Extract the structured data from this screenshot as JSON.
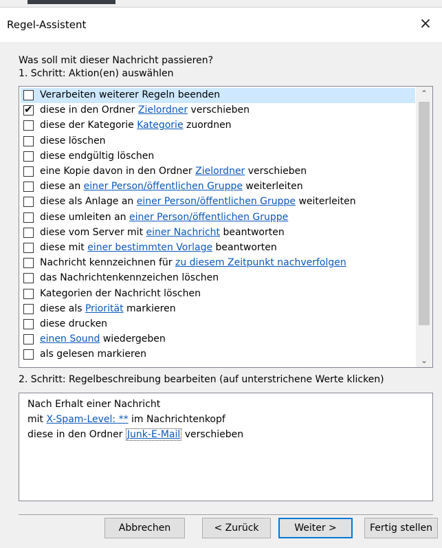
{
  "window": {
    "title": "Regel-Assistent"
  },
  "question": "Was soll mit dieser Nachricht passieren?",
  "step1_label": "1. Schritt: Aktion(en) auswählen",
  "actions": [
    {
      "checked": false,
      "selected": true,
      "parts": [
        {
          "t": "Verarbeiten weiterer Regeln beenden"
        }
      ]
    },
    {
      "checked": true,
      "parts": [
        {
          "t": "diese in den Ordner "
        },
        {
          "t": "Zielordner",
          "link": true
        },
        {
          "t": " verschieben"
        }
      ]
    },
    {
      "checked": false,
      "parts": [
        {
          "t": "diese der Kategorie "
        },
        {
          "t": "Kategorie",
          "link": true
        },
        {
          "t": " zuordnen"
        }
      ]
    },
    {
      "checked": false,
      "parts": [
        {
          "t": "diese löschen"
        }
      ]
    },
    {
      "checked": false,
      "parts": [
        {
          "t": "diese endgültig löschen"
        }
      ]
    },
    {
      "checked": false,
      "parts": [
        {
          "t": "eine Kopie davon in den Ordner "
        },
        {
          "t": "Zielordner",
          "link": true
        },
        {
          "t": " verschieben"
        }
      ]
    },
    {
      "checked": false,
      "parts": [
        {
          "t": "diese an "
        },
        {
          "t": "einer Person/öffentlichen Gruppe",
          "link": true
        },
        {
          "t": " weiterleiten"
        }
      ]
    },
    {
      "checked": false,
      "parts": [
        {
          "t": "diese als Anlage an "
        },
        {
          "t": "einer Person/öffentlichen Gruppe",
          "link": true
        },
        {
          "t": " weiterleiten"
        }
      ]
    },
    {
      "checked": false,
      "parts": [
        {
          "t": "diese umleiten an "
        },
        {
          "t": "einer Person/öffentlichen Gruppe",
          "link": true
        }
      ]
    },
    {
      "checked": false,
      "parts": [
        {
          "t": "diese vom Server mit "
        },
        {
          "t": "einer Nachricht",
          "link": true
        },
        {
          "t": " beantworten"
        }
      ]
    },
    {
      "checked": false,
      "parts": [
        {
          "t": "diese mit "
        },
        {
          "t": "einer bestimmten Vorlage",
          "link": true
        },
        {
          "t": " beantworten"
        }
      ]
    },
    {
      "checked": false,
      "parts": [
        {
          "t": "Nachricht kennzeichnen für "
        },
        {
          "t": "zu diesem Zeitpunkt nachverfolgen",
          "link": true
        }
      ]
    },
    {
      "checked": false,
      "parts": [
        {
          "t": "das Nachrichtenkennzeichen löschen"
        }
      ]
    },
    {
      "checked": false,
      "parts": [
        {
          "t": "Kategorien der Nachricht löschen"
        }
      ]
    },
    {
      "checked": false,
      "parts": [
        {
          "t": "diese als "
        },
        {
          "t": "Priorität",
          "link": true
        },
        {
          "t": " markieren"
        }
      ]
    },
    {
      "checked": false,
      "parts": [
        {
          "t": "diese drucken"
        }
      ]
    },
    {
      "checked": false,
      "parts": [
        {
          "t": "einen Sound",
          "link": true
        },
        {
          "t": " wiedergeben"
        }
      ]
    },
    {
      "checked": false,
      "parts": [
        {
          "t": "als gelesen markieren"
        }
      ]
    }
  ],
  "step2_label": "2. Schritt: Regelbeschreibung bearbeiten (auf unterstrichene Werte klicken)",
  "description": {
    "line1": "Nach Erhalt einer Nachricht",
    "line2_pre": "mit ",
    "line2_link": "X-Spam-Level: **",
    "line2_post": " im Nachrichtenkopf",
    "line3_pre": "diese in den Ordner ",
    "line3_link": "Junk-E-Mail",
    "line3_post": " verschieben"
  },
  "buttons": {
    "cancel": "Abbrechen",
    "back": "< Zurück",
    "next": "Weiter >",
    "finish": "Fertig stellen"
  },
  "icons": {
    "close": "×",
    "check": "✔",
    "scroll_up": "⌃",
    "scroll_down": "⌄"
  }
}
